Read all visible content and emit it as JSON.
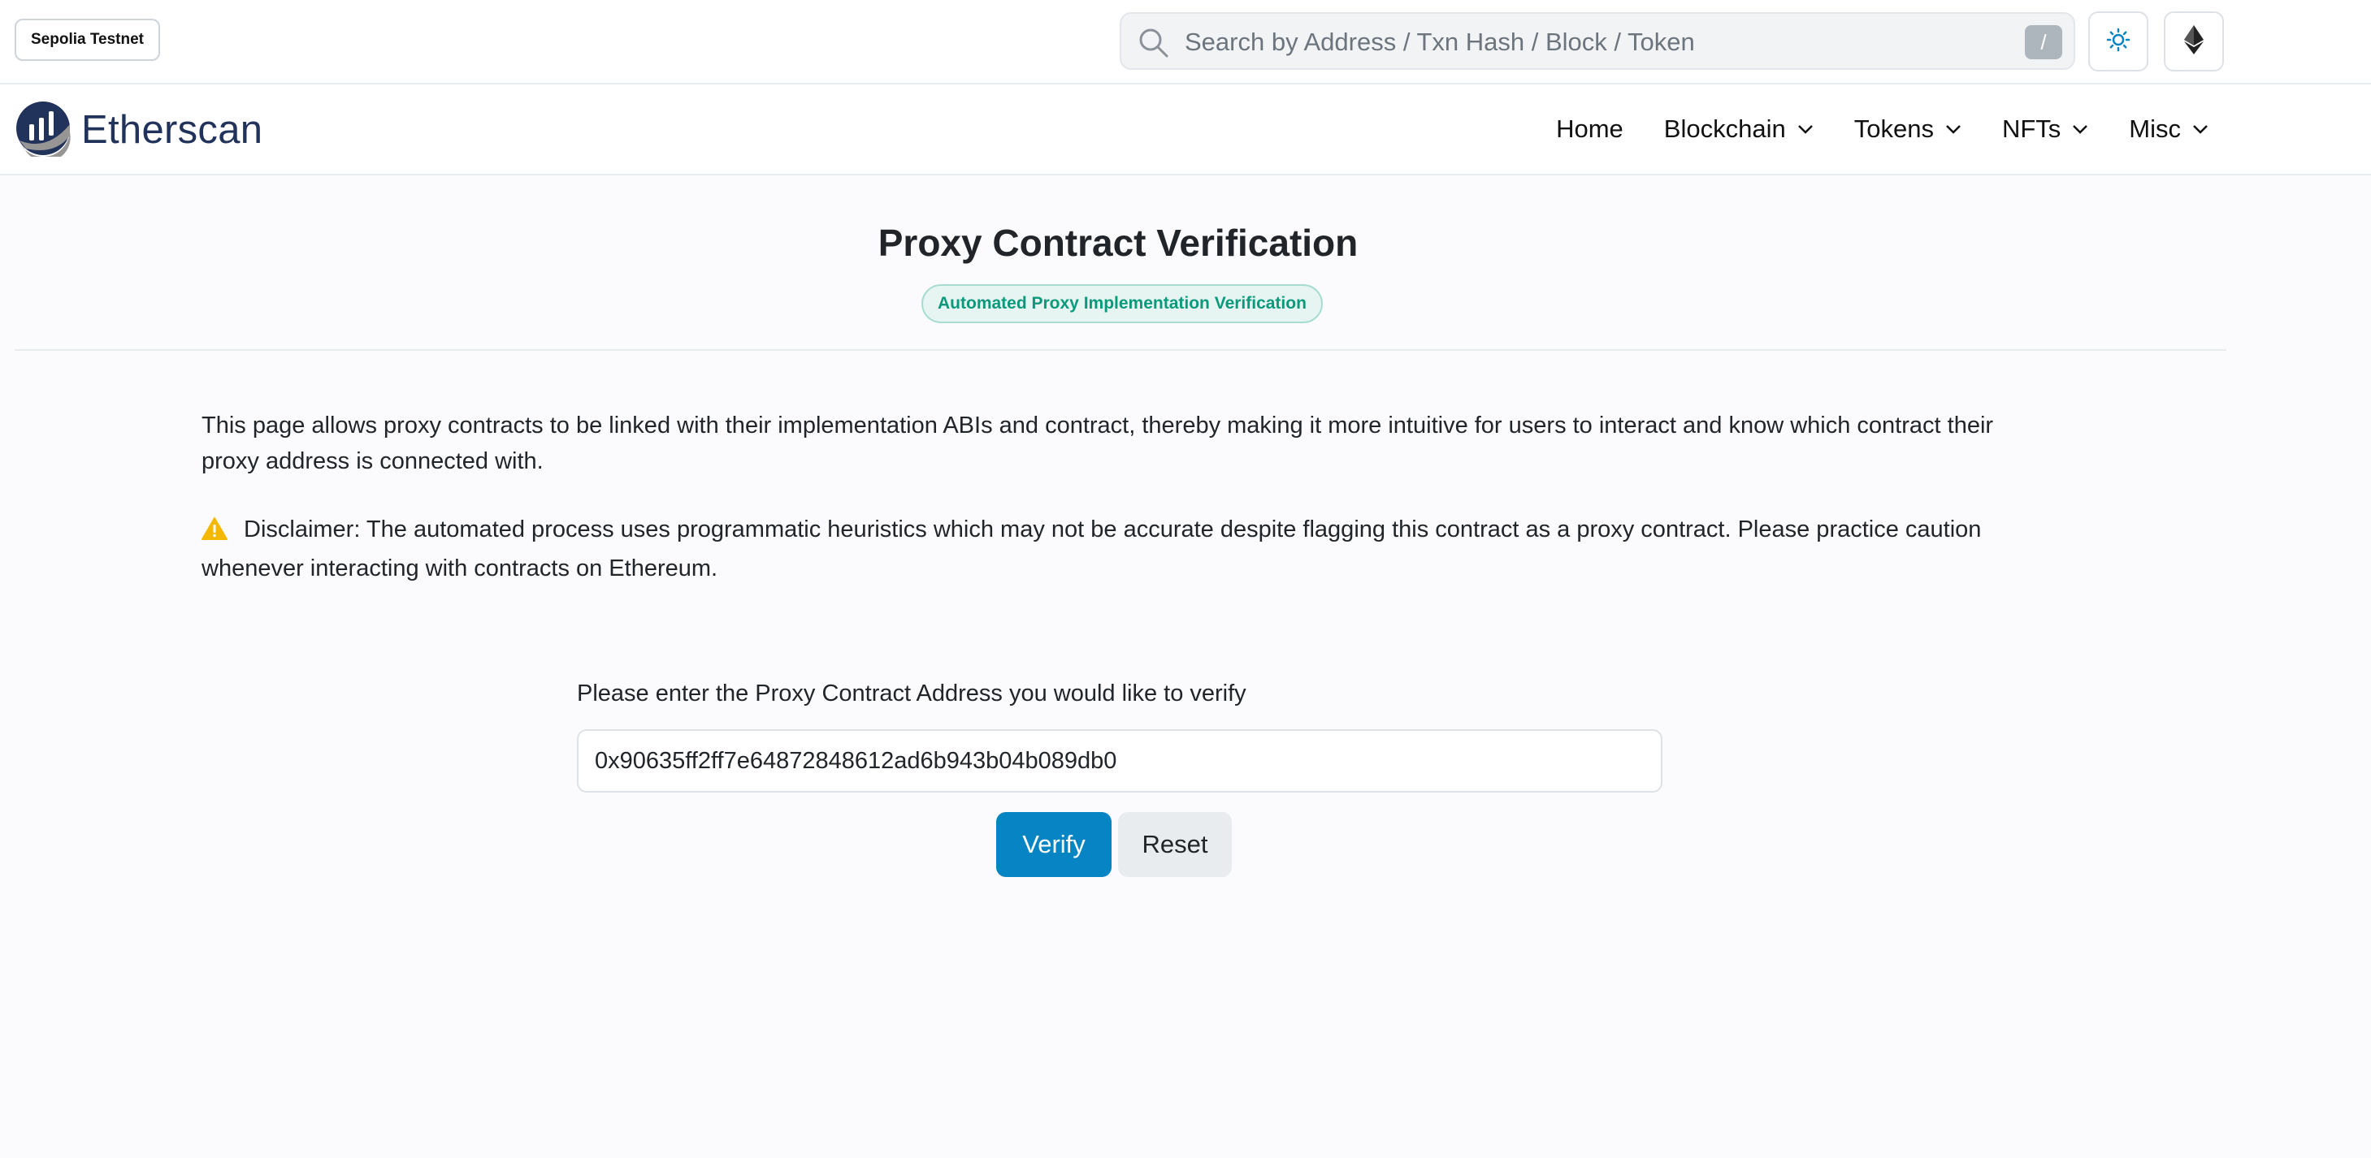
{
  "topbar": {
    "network_label": "Sepolia Testnet",
    "search": {
      "placeholder": "Search by Address / Txn Hash / Block / Token",
      "shortcut_key": "/"
    },
    "theme_icon": "sun-icon",
    "network_icon": "ethereum-icon"
  },
  "navbar": {
    "logo_text": "Etherscan",
    "items": [
      {
        "label": "Home",
        "has_dropdown": false
      },
      {
        "label": "Blockchain",
        "has_dropdown": true
      },
      {
        "label": "Tokens",
        "has_dropdown": true
      },
      {
        "label": "NFTs",
        "has_dropdown": true
      },
      {
        "label": "Misc",
        "has_dropdown": true
      }
    ]
  },
  "header": {
    "title": "Proxy Contract Verification",
    "badge": "Automated Proxy Implementation Verification"
  },
  "content": {
    "description": "This page allows proxy contracts to be linked with their implementation ABIs and contract, thereby making it more intuitive for users to interact and know which contract their proxy address is connected with.",
    "disclaimer": "Disclaimer: The automated process uses programmatic heuristics which may not be accurate despite flagging this contract as a proxy contract. Please practice caution whenever interacting with contracts on Ethereum."
  },
  "form": {
    "label": "Please enter the Proxy Contract Address you would like to verify",
    "address_value": "0x90635ff2ff7e64872848612ad6b943b04b089db0",
    "verify_label": "Verify",
    "reset_label": "Reset"
  },
  "colors": {
    "primary": "#0784c3",
    "brand": "#21325b",
    "badge_green": "#0a9a7b",
    "warning": "#f5b800"
  }
}
